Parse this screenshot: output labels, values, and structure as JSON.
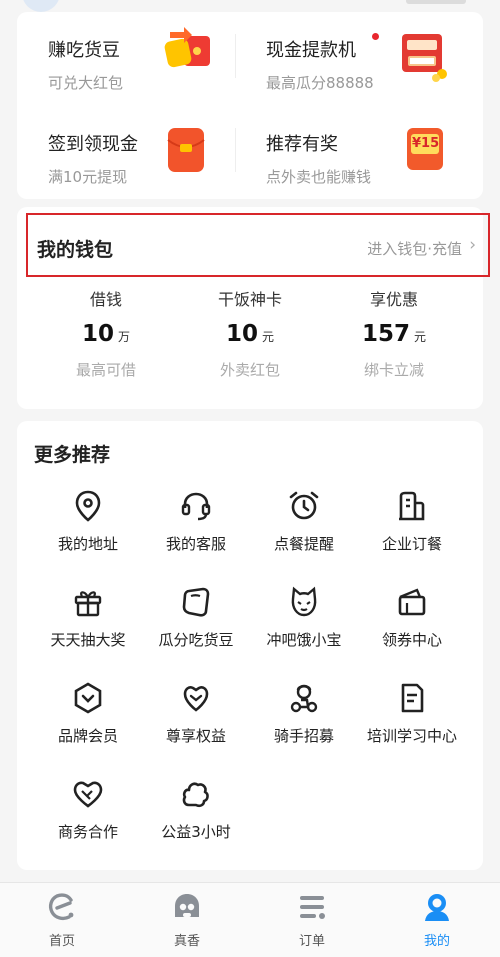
{
  "promo": {
    "items": [
      {
        "title": "赚吃货豆",
        "subtitle": "可兑大红包"
      },
      {
        "title": "现金提款机",
        "subtitle": "最高瓜分88888"
      },
      {
        "title": "签到领现金",
        "subtitle": "满10元提现"
      },
      {
        "title": "推荐有奖",
        "subtitle": "点外卖也能赚钱"
      }
    ],
    "coupon_badge": "¥15"
  },
  "wallet": {
    "title": "我的钱包",
    "link": "进入钱包·充值",
    "columns": [
      {
        "label": "借钱",
        "value": "10",
        "unit": "万",
        "desc": "最高可借"
      },
      {
        "label": "干饭神卡",
        "value": "10",
        "unit": "元",
        "desc": "外卖红包"
      },
      {
        "label": "享优惠",
        "value": "157",
        "unit": "元",
        "desc": "绑卡立减"
      }
    ]
  },
  "more": {
    "title": "更多推荐",
    "items": [
      {
        "label": "我的地址",
        "icon": "location-pin-icon"
      },
      {
        "label": "我的客服",
        "icon": "headset-icon"
      },
      {
        "label": "点餐提醒",
        "icon": "alarm-clock-icon"
      },
      {
        "label": "企业订餐",
        "icon": "building-icon"
      },
      {
        "label": "天天抽大奖",
        "icon": "gift-icon"
      },
      {
        "label": "瓜分吃货豆",
        "icon": "bean-icon"
      },
      {
        "label": "冲吧饿小宝",
        "icon": "cat-face-icon"
      },
      {
        "label": "领券中心",
        "icon": "coupon-icon"
      },
      {
        "label": "品牌会员",
        "icon": "brand-member-icon"
      },
      {
        "label": "尊享权益",
        "icon": "heart-badge-icon"
      },
      {
        "label": "骑手招募",
        "icon": "rider-icon"
      },
      {
        "label": "培训学习中心",
        "icon": "document-icon"
      },
      {
        "label": "商务合作",
        "icon": "handshake-icon"
      },
      {
        "label": "公益3小时",
        "icon": "cloud-heart-icon"
      }
    ]
  },
  "tabbar": {
    "tabs": [
      {
        "label": "首页",
        "icon": "home-e-icon"
      },
      {
        "label": "真香",
        "icon": "ghost-face-icon"
      },
      {
        "label": "订单",
        "icon": "order-list-icon"
      },
      {
        "label": "我的",
        "icon": "profile-icon"
      }
    ],
    "active_color": "#1a8ef5"
  },
  "colors": {
    "highlight_border": "#d8262a",
    "accent_red": "#e8262e"
  }
}
